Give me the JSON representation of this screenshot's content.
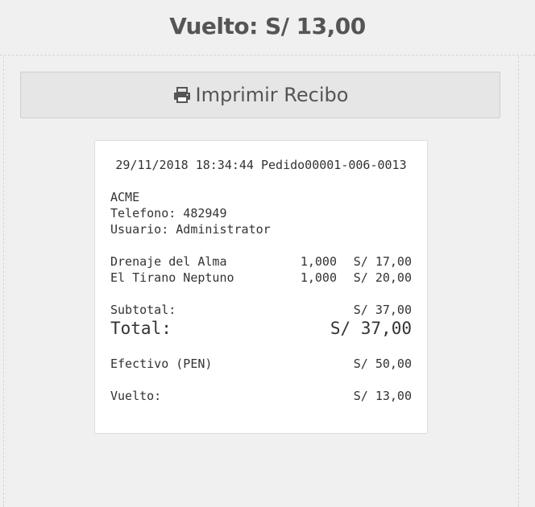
{
  "header": {
    "change_title": "Vuelto: S/ 13,00"
  },
  "print_button": {
    "label": "Imprimir Recibo",
    "icon": "print-icon"
  },
  "receipt": {
    "header_line": "29/11/2018 18:34:44 Pedido00001-006-0013",
    "business_name": "ACME",
    "phone": "Telefono: 482949",
    "user": "Usuario: Administrator",
    "items": [
      {
        "name": "Drenaje del Alma",
        "qty": "1,000",
        "price": "S/ 17,00"
      },
      {
        "name": "El Tirano Neptuno",
        "qty": "1,000",
        "price": "S/ 20,00"
      }
    ],
    "subtotal_label": "Subtotal:",
    "subtotal_value": "S/ 37,00",
    "total_label": "Total:",
    "total_value": "S/ 37,00",
    "payment_label": "Efectivo (PEN)",
    "payment_value": "S/ 50,00",
    "change_label": "Vuelto:",
    "change_value": "S/ 13,00"
  }
}
